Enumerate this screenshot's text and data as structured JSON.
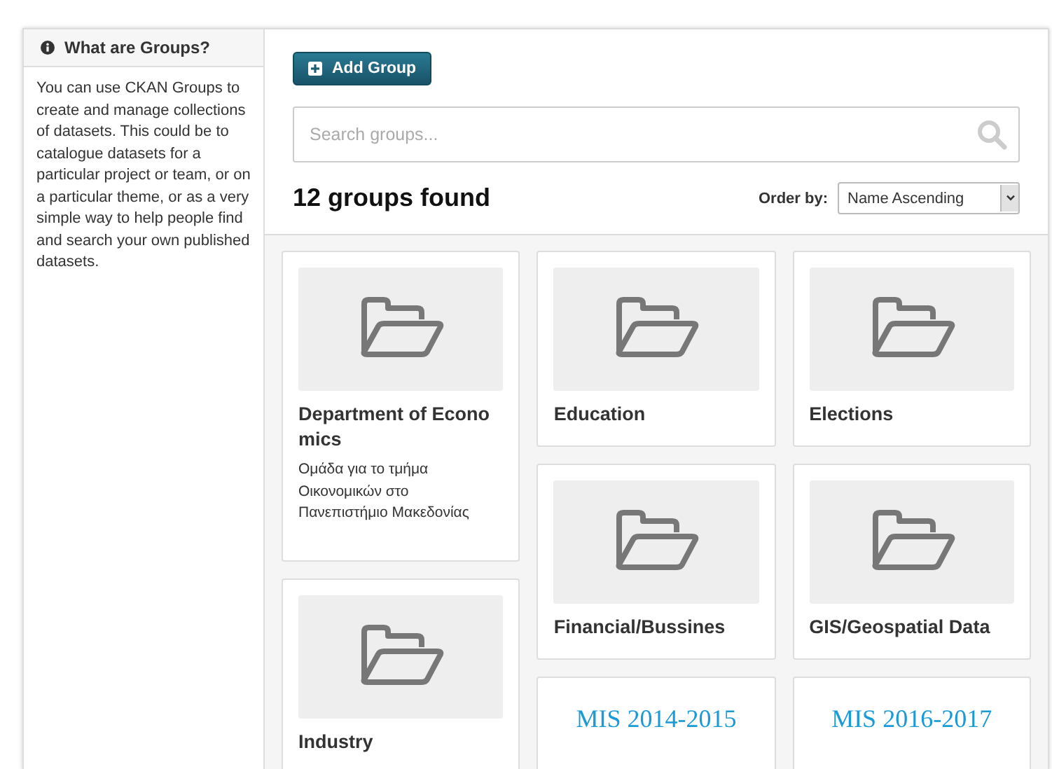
{
  "sidebar": {
    "title": "What are Groups?",
    "text": "You can use CKAN Groups to create and manage collections of datasets. This could be to catalogue datasets for a particular project or team, or on a particular theme, or as a very simple way to help people find and search your own published datasets."
  },
  "add_button": "Add Group",
  "search": {
    "placeholder": "Search groups..."
  },
  "result_count": "12 groups found",
  "order_by": {
    "label": "Order by:",
    "value": "Name Ascending"
  },
  "group_columns": [
    {
      "groups": [
        {
          "kind": "placeholder",
          "title": "Department of Econo mics",
          "description": "Ομάδα για το τμήμα Οικονομικών στο Πανεπιστήμιο Μακεδονίας"
        },
        {
          "kind": "placeholder",
          "title": "Industry"
        }
      ]
    },
    {
      "groups": [
        {
          "kind": "placeholder",
          "title": "Education"
        },
        {
          "kind": "placeholder",
          "title": "Financial/Bussines"
        },
        {
          "kind": "logo",
          "logo_text": "MIS 2014-2015"
        }
      ]
    },
    {
      "groups": [
        {
          "kind": "placeholder",
          "title": "Elections"
        },
        {
          "kind": "placeholder",
          "title": "GIS/Geospatial Data"
        },
        {
          "kind": "logo",
          "logo_text": "MIS 2016-2017"
        }
      ]
    }
  ]
}
